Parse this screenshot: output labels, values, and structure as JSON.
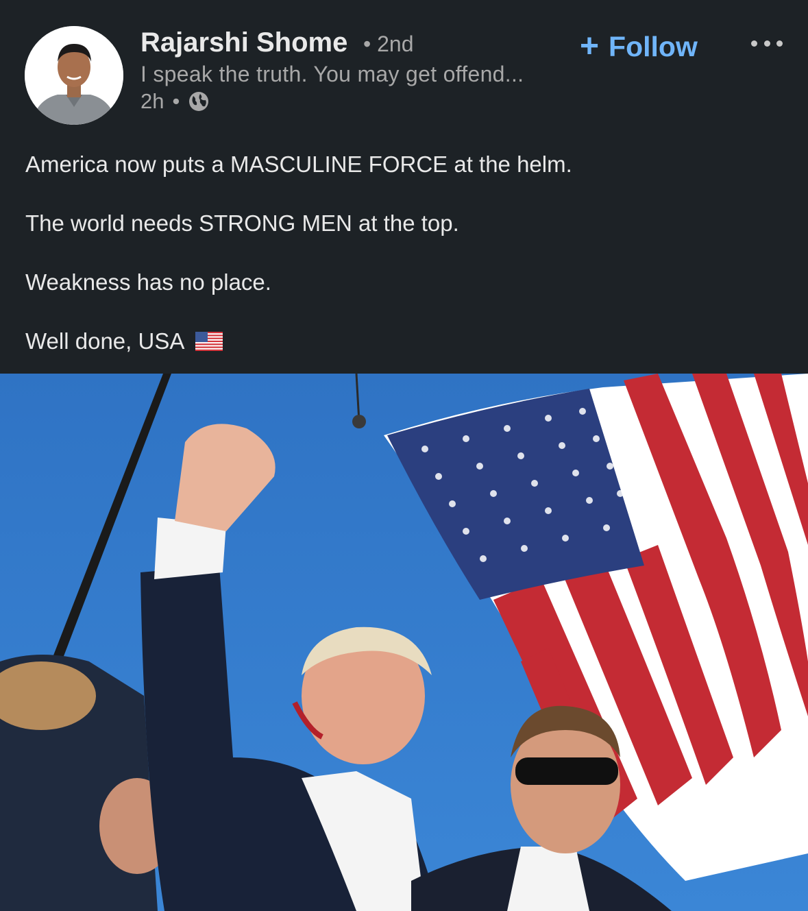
{
  "post": {
    "author": {
      "name": "Rajarshi Shome",
      "degree": "• 2nd",
      "headline": "I speak the truth. You may get offend...",
      "time": "2h",
      "separator": "•",
      "visibility_icon": "globe-icon"
    },
    "follow_label": "Follow",
    "follow_plus": "+",
    "more_icon": "more-options-icon",
    "text": {
      "line1": "America now puts a MASCULINE FORCE at the helm.",
      "line2": "The world needs STRONG MEN at the top.",
      "line3": "Weakness has no place.",
      "line4": "Well done, USA"
    },
    "emoji": "us-flag-emoji",
    "image": "photo-raised-fist-flag"
  },
  "colors": {
    "background": "#1d2226",
    "accent": "#70b5f9",
    "text": "#e9e9e9",
    "muted": "#a8a8a8"
  }
}
